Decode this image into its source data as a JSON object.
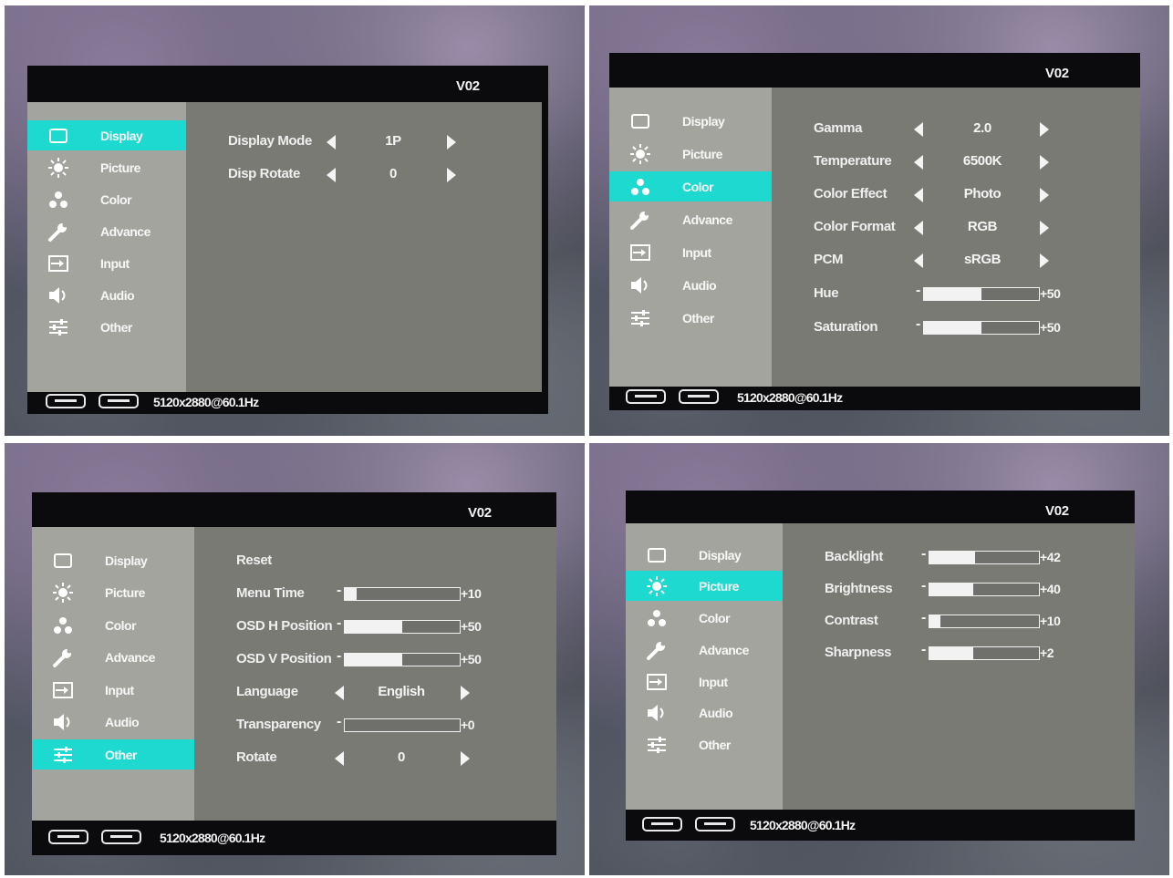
{
  "screens": {
    "display": {
      "version": "V02",
      "nav": [
        "Display",
        "Picture",
        "Color",
        "Advance",
        "Input",
        "Audio",
        "Other"
      ],
      "active": "Display",
      "settings": {
        "display_mode": {
          "label": "Display Mode",
          "value": "1P"
        },
        "disp_rotate": {
          "label": "Disp Rotate",
          "value": "0"
        }
      },
      "resolution": "5120x2880@60.1Hz"
    },
    "color": {
      "version": "V02",
      "nav": [
        "Display",
        "Picture",
        "Color",
        "Advance",
        "Input",
        "Audio",
        "Other"
      ],
      "active": "Color",
      "settings": {
        "gamma": {
          "label": "Gamma",
          "value": "2.0"
        },
        "temperature": {
          "label": "Temperature",
          "value": "6500K"
        },
        "color_effect": {
          "label": "Color Effect",
          "value": "Photo"
        },
        "color_format": {
          "label": "Color Format",
          "value": "RGB"
        },
        "pcm": {
          "label": "PCM",
          "value": "sRGB"
        },
        "hue": {
          "label": "Hue",
          "value": "50",
          "level": 50
        },
        "saturation": {
          "label": "Saturation",
          "value": "50",
          "level": 50
        }
      },
      "resolution": "5120x2880@60.1Hz"
    },
    "other": {
      "version": "V02",
      "nav": [
        "Display",
        "Picture",
        "Color",
        "Advance",
        "Input",
        "Audio",
        "Other"
      ],
      "active": "Other",
      "settings": {
        "reset": {
          "label": "Reset"
        },
        "menu_time": {
          "label": "Menu Time",
          "value": "10",
          "level": 10
        },
        "osd_h": {
          "label": "OSD H Position",
          "value": "50",
          "level": 50
        },
        "osd_v": {
          "label": "OSD V Position",
          "value": "50",
          "level": 50
        },
        "language": {
          "label": "Language",
          "value": "English"
        },
        "transparency": {
          "label": "Transparency",
          "value": "0",
          "level": 0
        },
        "rotate": {
          "label": "Rotate",
          "value": "0"
        }
      },
      "resolution": "5120x2880@60.1Hz"
    },
    "picture": {
      "version": "V02",
      "nav": [
        "Display",
        "Picture",
        "Color",
        "Advance",
        "Input",
        "Audio",
        "Other"
      ],
      "active": "Picture",
      "settings": {
        "backlight": {
          "label": "Backlight",
          "value": "42",
          "level": 42
        },
        "brightness": {
          "label": "Brightness",
          "value": "40",
          "level": 40
        },
        "contrast": {
          "label": "Contrast",
          "value": "10",
          "level": 10
        },
        "sharpness": {
          "label": "Sharpness",
          "value": "2",
          "level": 40
        }
      },
      "resolution": "5120x2880@60.1Hz"
    }
  },
  "icons": [
    "monitor-icon",
    "sun-icon",
    "color-dots-icon",
    "wrench-icon",
    "input-icon",
    "speaker-icon",
    "sliders-icon"
  ],
  "colors": {
    "highlight": "#1ed9cf",
    "sidebar": "#a4a49e",
    "content": "#7a7a75",
    "osd_frame": "#0b0b0d"
  }
}
